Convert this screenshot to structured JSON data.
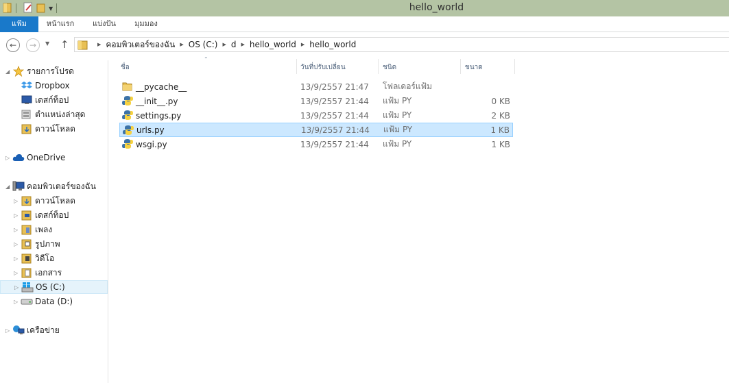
{
  "window": {
    "title": "hello_world"
  },
  "ribbon": {
    "tabs": [
      {
        "label": "แฟ้ม"
      },
      {
        "label": "หน้าแรก"
      },
      {
        "label": "แบ่งปัน"
      },
      {
        "label": "มุมมอง"
      }
    ]
  },
  "address": {
    "crumbs": [
      "คอมพิวเตอร์ของฉัน",
      "OS (C:)",
      "d",
      "hello_world",
      "hello_world"
    ]
  },
  "nav": {
    "favorites": {
      "label": "รายการโปรด"
    },
    "favorite_items": [
      {
        "label": "Dropbox",
        "icon": "dropbox-icon"
      },
      {
        "label": "เดสก์ท็อป",
        "icon": "desktop-icon"
      },
      {
        "label": "ตำแหน่งล่าสุด",
        "icon": "recent-places-icon"
      },
      {
        "label": "ดาวน์โหลด",
        "icon": "downloads-icon"
      }
    ],
    "onedrive": {
      "label": "OneDrive"
    },
    "computer": {
      "label": "คอมพิวเตอร์ของฉัน"
    },
    "computer_items": [
      {
        "label": "ดาวน์โหลด",
        "icon": "downloads-folder-icon"
      },
      {
        "label": "เดสก์ท็อป",
        "icon": "desktop-folder-icon"
      },
      {
        "label": "เพลง",
        "icon": "music-folder-icon"
      },
      {
        "label": "รูปภาพ",
        "icon": "pictures-folder-icon"
      },
      {
        "label": "วิดีโอ",
        "icon": "videos-folder-icon"
      },
      {
        "label": "เอกสาร",
        "icon": "documents-folder-icon"
      },
      {
        "label": "OS (C:)",
        "icon": "windows-drive-icon"
      },
      {
        "label": "Data (D:)",
        "icon": "drive-icon"
      }
    ],
    "network": {
      "label": "เครือข่าย"
    }
  },
  "columns": {
    "name": "ชื่อ",
    "date": "วันที่ปรับเปลี่ยน",
    "type": "ชนิด",
    "size": "ขนาด"
  },
  "files": [
    {
      "name": "__pycache__",
      "date": "13/9/2557 21:47",
      "type": "โฟลเดอร์แฟ้ม",
      "size": "",
      "icon": "folder-icon"
    },
    {
      "name": "__init__.py",
      "date": "13/9/2557 21:44",
      "type": "แฟ้ม PY",
      "size": "0 KB",
      "icon": "python-file-icon"
    },
    {
      "name": "settings.py",
      "date": "13/9/2557 21:44",
      "type": "แฟ้ม PY",
      "size": "2 KB",
      "icon": "python-file-icon"
    },
    {
      "name": "urls.py",
      "date": "13/9/2557 21:44",
      "type": "แฟ้ม PY",
      "size": "1 KB",
      "icon": "python-file-icon"
    },
    {
      "name": "wsgi.py",
      "date": "13/9/2557 21:44",
      "type": "แฟ้ม PY",
      "size": "1 KB",
      "icon": "python-file-icon"
    }
  ],
  "colors": {
    "titlebar": "#b4c4a4",
    "file_tab": "#1979ca",
    "selection": "#cce8ff"
  }
}
